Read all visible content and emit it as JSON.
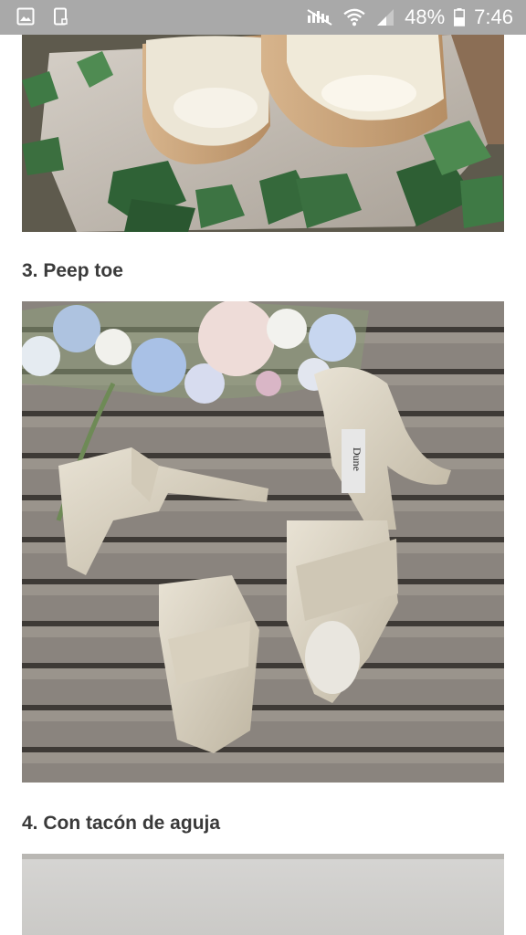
{
  "status_bar": {
    "battery_percent": "48%",
    "time": "7:46",
    "left_icons": [
      "gallery-icon",
      "tablet-icon"
    ],
    "right_icons": [
      "mute-icon",
      "wifi-icon",
      "signal-icon",
      "battery-icon"
    ]
  },
  "article": {
    "sections": [
      {
        "heading": "3. Peep toe"
      },
      {
        "heading": "4. Con tacón de aguja"
      }
    ],
    "photo2_brand_label": "Dune"
  }
}
